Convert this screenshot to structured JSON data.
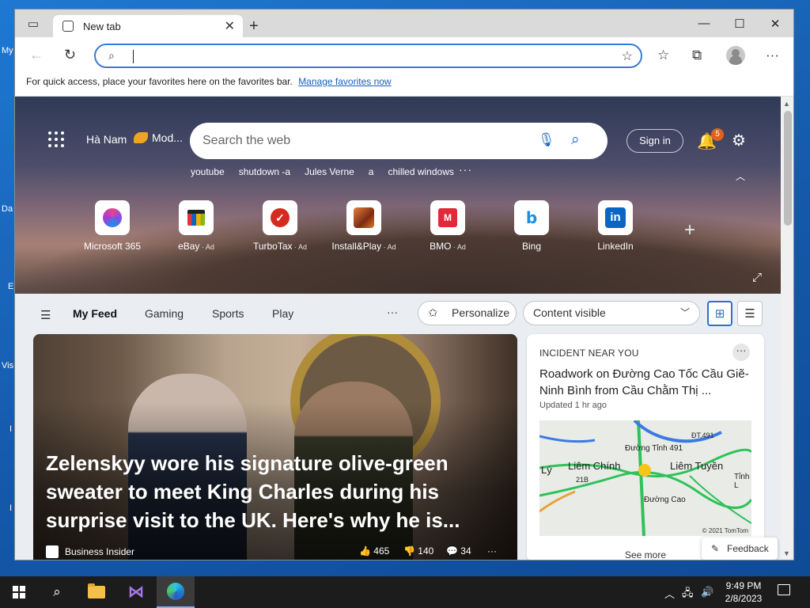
{
  "desktop": {
    "labels": [
      "My",
      "Da",
      "E",
      "Vis",
      "I",
      "I"
    ]
  },
  "browser": {
    "tab_title": "New tab",
    "address_value": "",
    "favbar_text": "For quick access, place your favorites here on the favorites bar.",
    "favbar_link": "Manage favorites now"
  },
  "hero": {
    "location": "Hà Nam",
    "weather": "Mod...",
    "search_placeholder": "Search the web",
    "quick_links": [
      "youtube",
      "shutdown -a",
      "Jules Verne",
      "a",
      "chilled windows"
    ],
    "more": "···",
    "sign_in": "Sign in",
    "notifications": "5",
    "tiles": [
      {
        "name": "Microsoft 365",
        "ad": ""
      },
      {
        "name": "eBay",
        "ad": " · Ad"
      },
      {
        "name": "TurboTax",
        "ad": " · Ad"
      },
      {
        "name": "Install&Play",
        "ad": " · Ad"
      },
      {
        "name": "BMO",
        "ad": " · Ad"
      },
      {
        "name": "Bing",
        "ad": ""
      },
      {
        "name": "LinkedIn",
        "ad": ""
      }
    ]
  },
  "feed": {
    "tabs": [
      "My Feed",
      "Gaming",
      "Sports",
      "Play"
    ],
    "more": "···",
    "personalize": "Personalize",
    "content_visibility": "Content visible"
  },
  "main_story": {
    "headline": "Zelenskyy wore his signature olive-green sweater to meet King Charles during his surprise visit to the UK. Here's why he is...",
    "source": "Business Insider",
    "likes": "465",
    "dislikes": "140",
    "comments": "34",
    "more": "···"
  },
  "incident": {
    "label": "INCIDENT NEAR YOU",
    "title": "Roadwork on Đường Cao Tốc Cầu Giẽ-Ninh Bình from Cầu Chằm Thị ...",
    "updated": "Updated 1 hr ago",
    "map_labels": [
      "Liêm Chính",
      "Liêm Tuyền",
      "Lý",
      "Đường Tỉnh 491",
      "ĐT.491",
      "21B",
      "Đường Cao",
      "Tỉnh L"
    ],
    "map_copyright": "© 2021 TomTom",
    "see_more": "See more"
  },
  "feedback": "Feedback",
  "taskbar": {
    "time": "9:49 PM",
    "date": "2/8/2023"
  }
}
